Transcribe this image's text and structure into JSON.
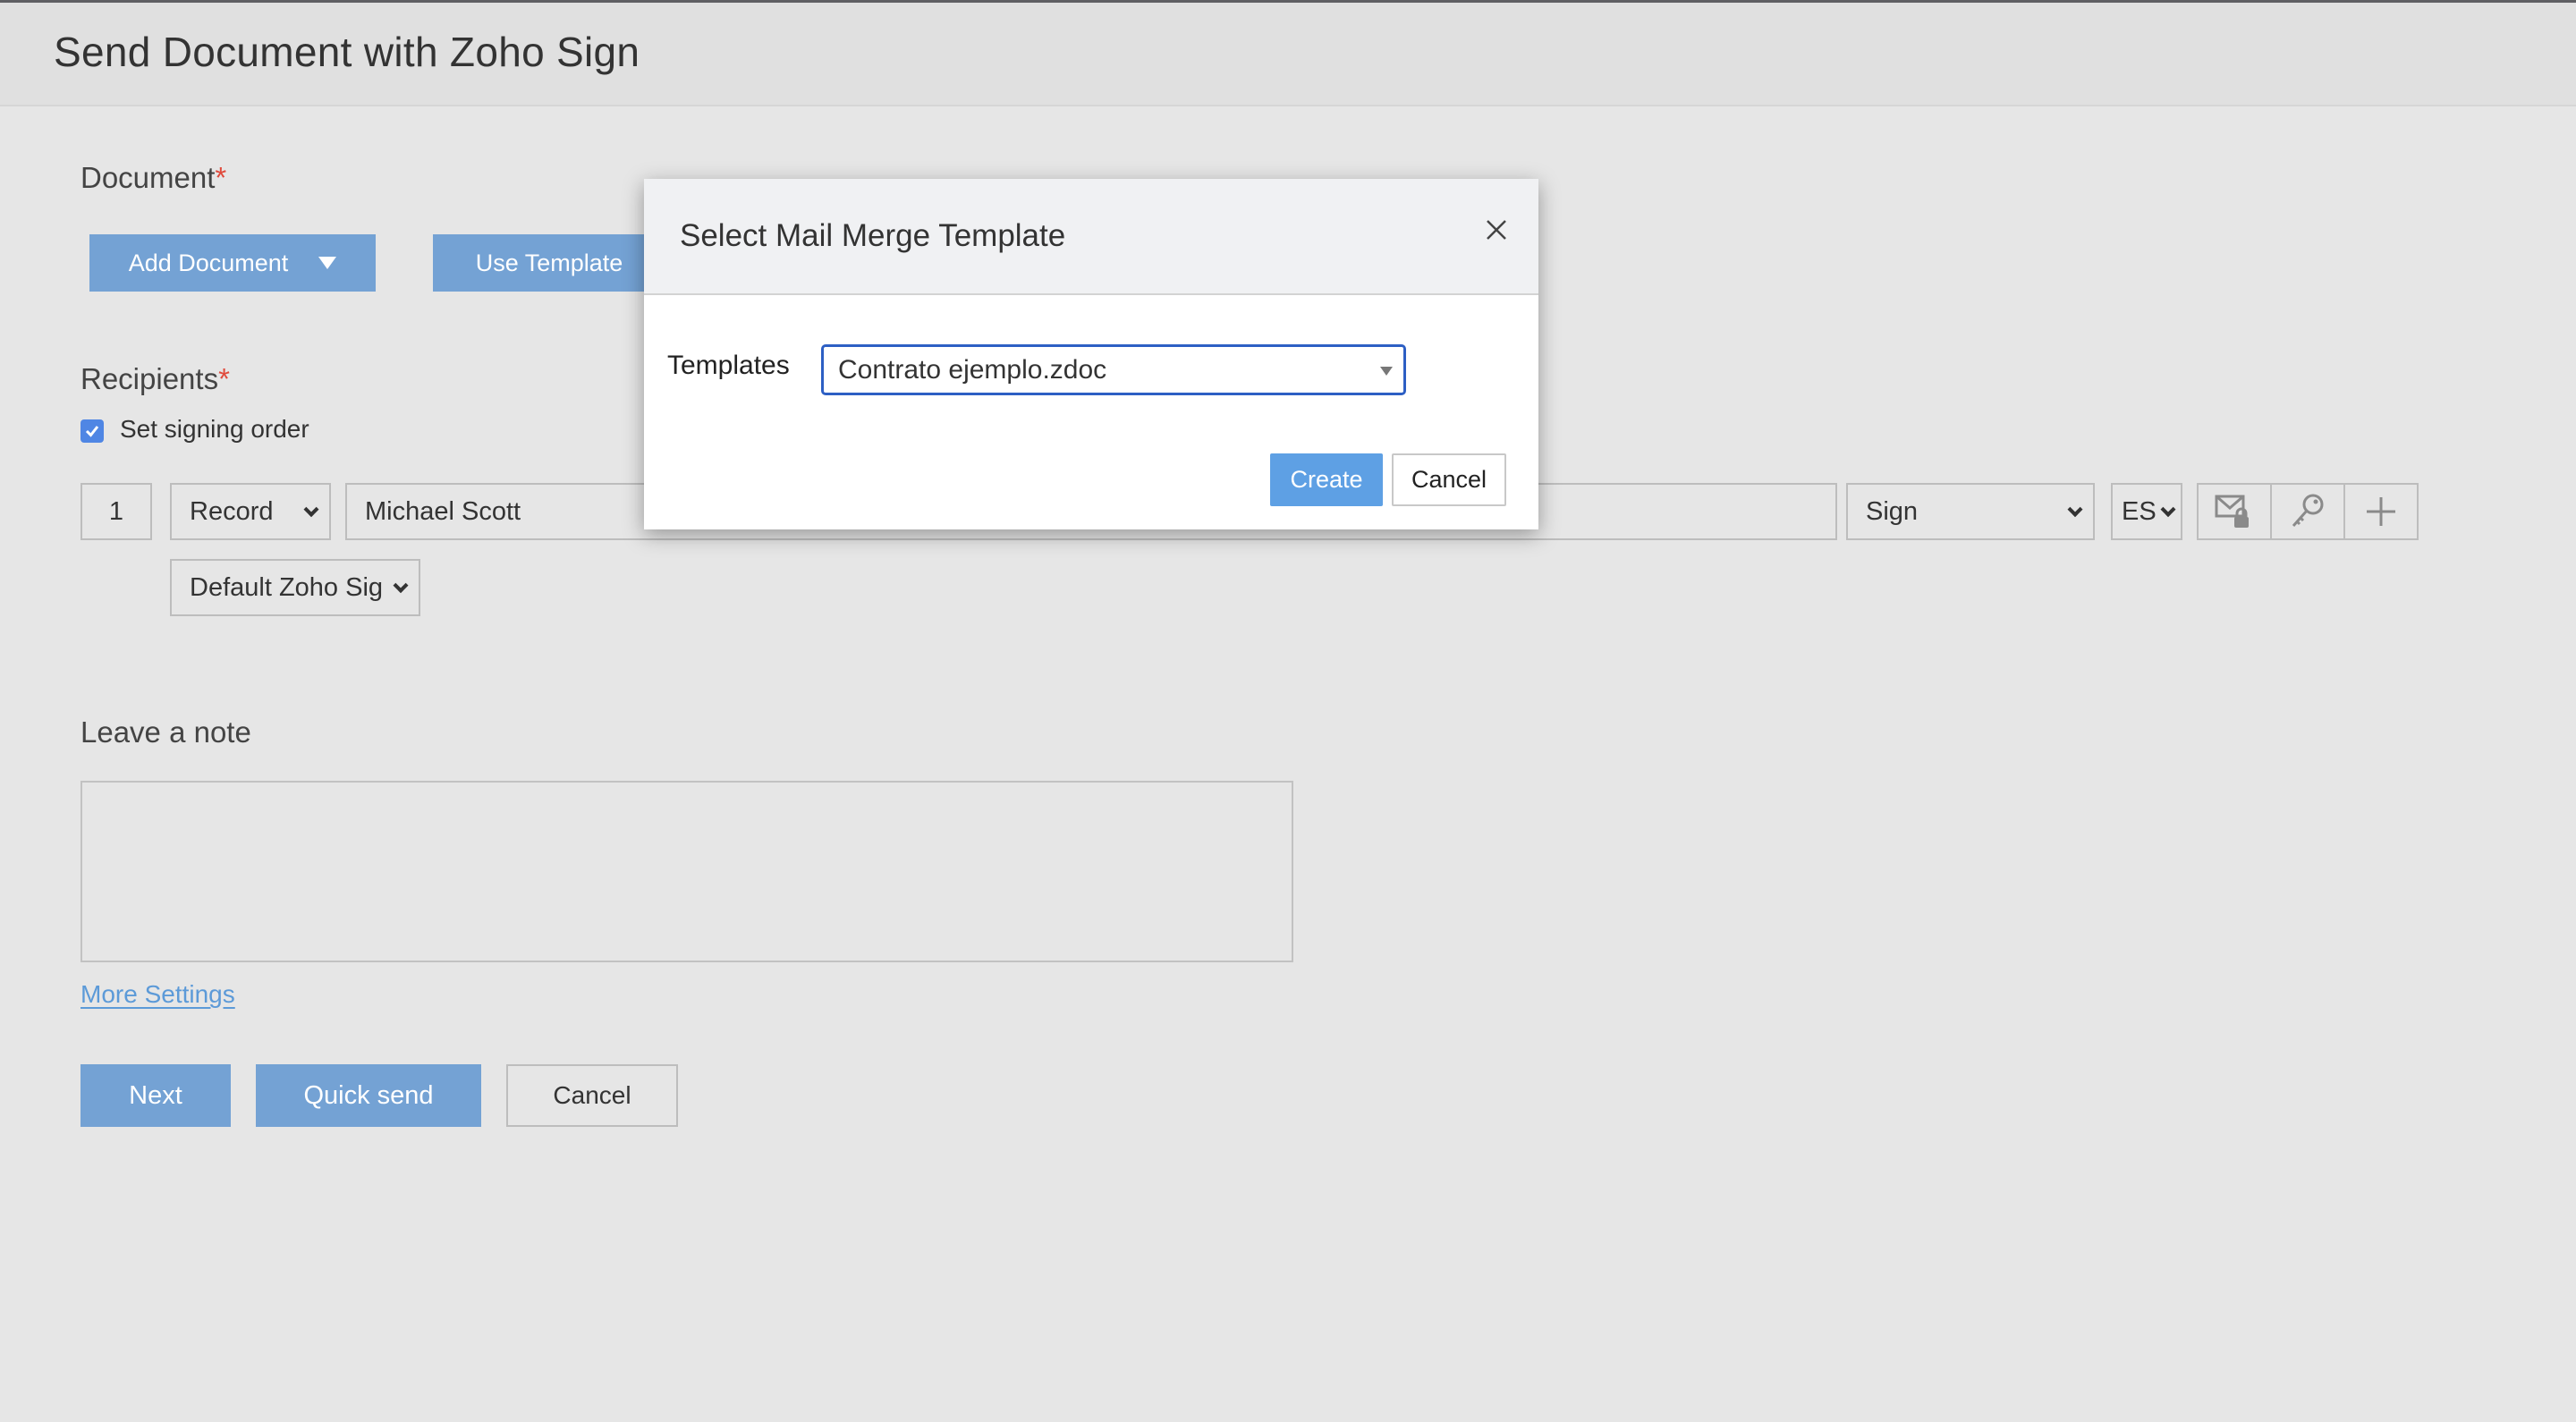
{
  "header": {
    "title": "Send Document with Zoho Sign"
  },
  "document": {
    "label": "Document",
    "required_mark": "*",
    "add_document_label": "Add Document",
    "use_template_label": "Use Template"
  },
  "recipients": {
    "label": "Recipients",
    "required_mark": "*",
    "signing_order_label": "Set signing order",
    "signing_order_checked": true,
    "rows": [
      {
        "order": "1",
        "type": "Record",
        "name": "Michael Scott",
        "email": "",
        "action": "Sign",
        "language": "ES",
        "signature_mode": "Default Zoho Sig"
      }
    ],
    "row_icons": [
      "email-lock-icon",
      "key-icon",
      "plus-icon"
    ]
  },
  "note": {
    "label": "Leave a note",
    "value": ""
  },
  "more_settings_label": "More Settings",
  "footer": {
    "next_label": "Next",
    "quick_send_label": "Quick send",
    "cancel_label": "Cancel"
  },
  "modal": {
    "title": "Select Mail Merge Template",
    "templates_label": "Templates",
    "templates_selected": "Contrato ejemplo.zdoc",
    "create_label": "Create",
    "cancel_label": "Cancel"
  },
  "colors": {
    "primary_button": "#74a2d4",
    "modal_primary": "#5ea0e4",
    "required": "#e04a3c",
    "link": "#5c9ad8",
    "focus_border": "#2d5fc4"
  }
}
